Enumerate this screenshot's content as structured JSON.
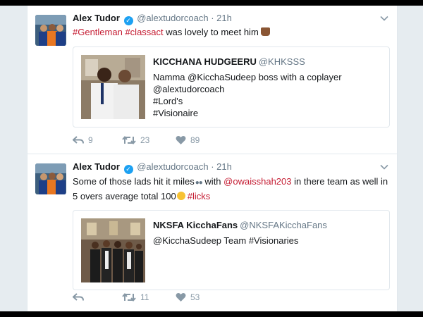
{
  "colors": {
    "accent": "#c51d33",
    "verified": "#1da1f2",
    "muted": "#657786"
  },
  "tweets": [
    {
      "author": "Alex Tudor",
      "handle": "@alextudorcoach",
      "time": "21h",
      "text_parts": [
        "#Gentleman",
        "#classact",
        "was lovely to meet him"
      ],
      "quote": {
        "name": "KICCHANA HUDGEERU",
        "handle": "@KHKSSS",
        "lines": [
          "Namma @KicchaSudeep boss with a coplayer",
          "@alextudorcoach",
          "#Lord's",
          "#Visionaire"
        ]
      },
      "replies": "9",
      "retweets": "23",
      "likes": "89"
    },
    {
      "author": "Alex Tudor",
      "handle": "@alextudorcoach",
      "time": "21h",
      "text_parts": [
        "Some of those lads hit it miles",
        "with",
        "@owaisshah203",
        "in there team as well in",
        "5 overs average total 100",
        "#licks"
      ],
      "quote": {
        "name": "NKSFA KicchaFans",
        "handle": "@NKSFAKicchaFans",
        "lines": [
          "@KicchaSudeep Team #Visionaries"
        ]
      },
      "replies": "",
      "retweets": "11",
      "likes": "53"
    }
  ],
  "icons": [
    "reply-icon",
    "retweet-icon",
    "like-icon",
    "caret-down-icon",
    "verified-icon"
  ]
}
